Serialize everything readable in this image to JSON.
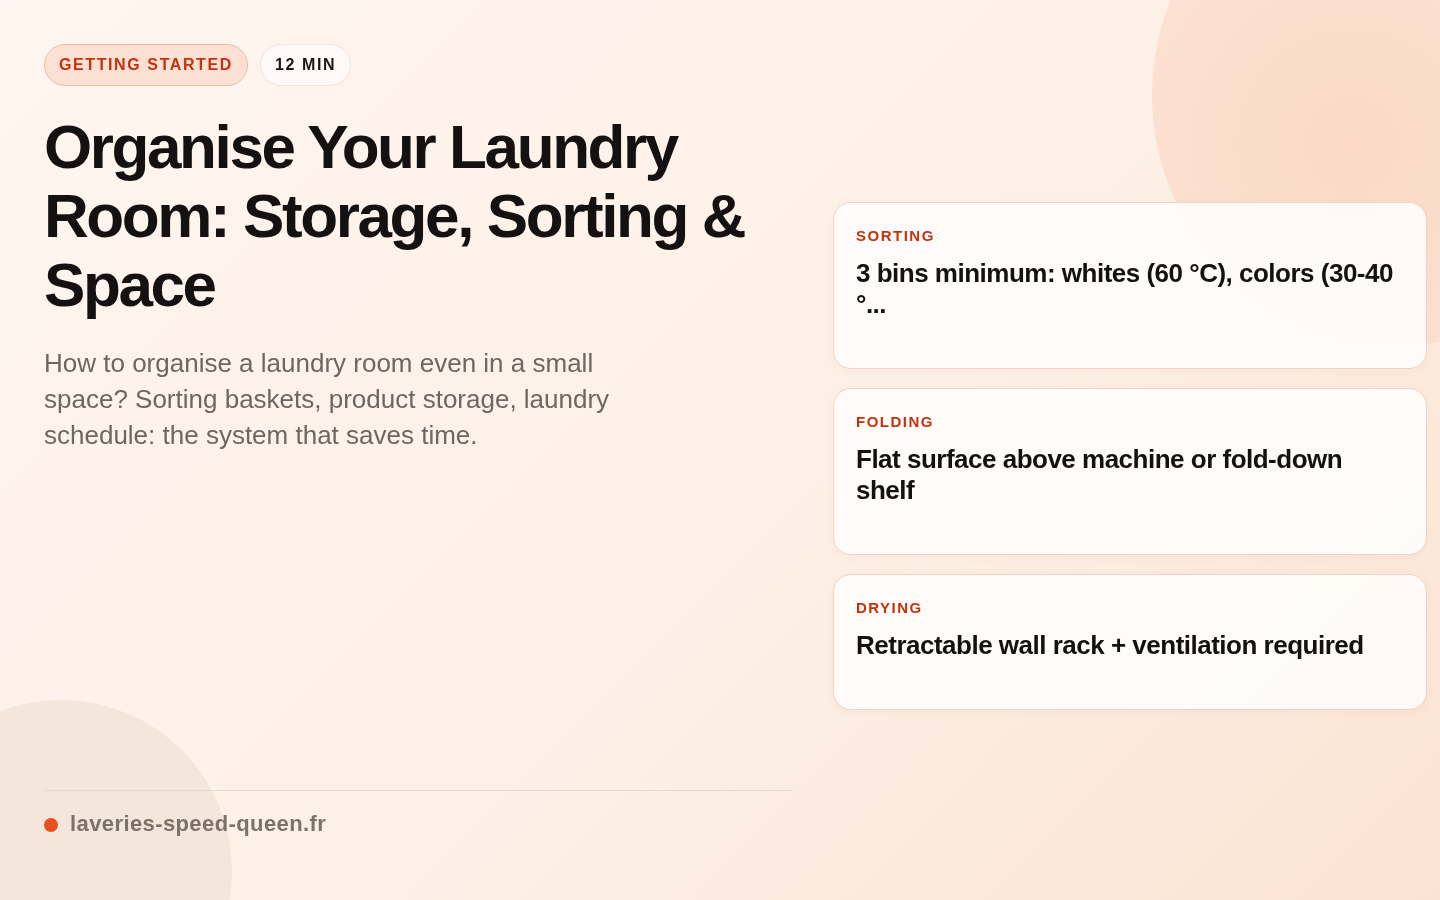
{
  "badges": [
    {
      "label": "GETTING STARTED",
      "kind": "category"
    },
    {
      "label": "12 MIN",
      "kind": "duration"
    }
  ],
  "title": "Organise Your Laundry Room: Storage, Sorting & Space",
  "subtitle": "How to organise a laundry room even in a small space? Sorting baskets, product storage, laundry schedule: the system that saves time.",
  "cards": [
    {
      "label": "SORTING",
      "text": "3 bins minimum: whites (60 °C), colors (30-40 °..."
    },
    {
      "label": "FOLDING",
      "text": "Flat surface above machine or fold-down shelf"
    },
    {
      "label": "DRYING",
      "text": "Retractable wall rack + ventilation required"
    }
  ],
  "footer": {
    "site": "laveries-speed-queen.fr",
    "color": "#e8501f"
  }
}
